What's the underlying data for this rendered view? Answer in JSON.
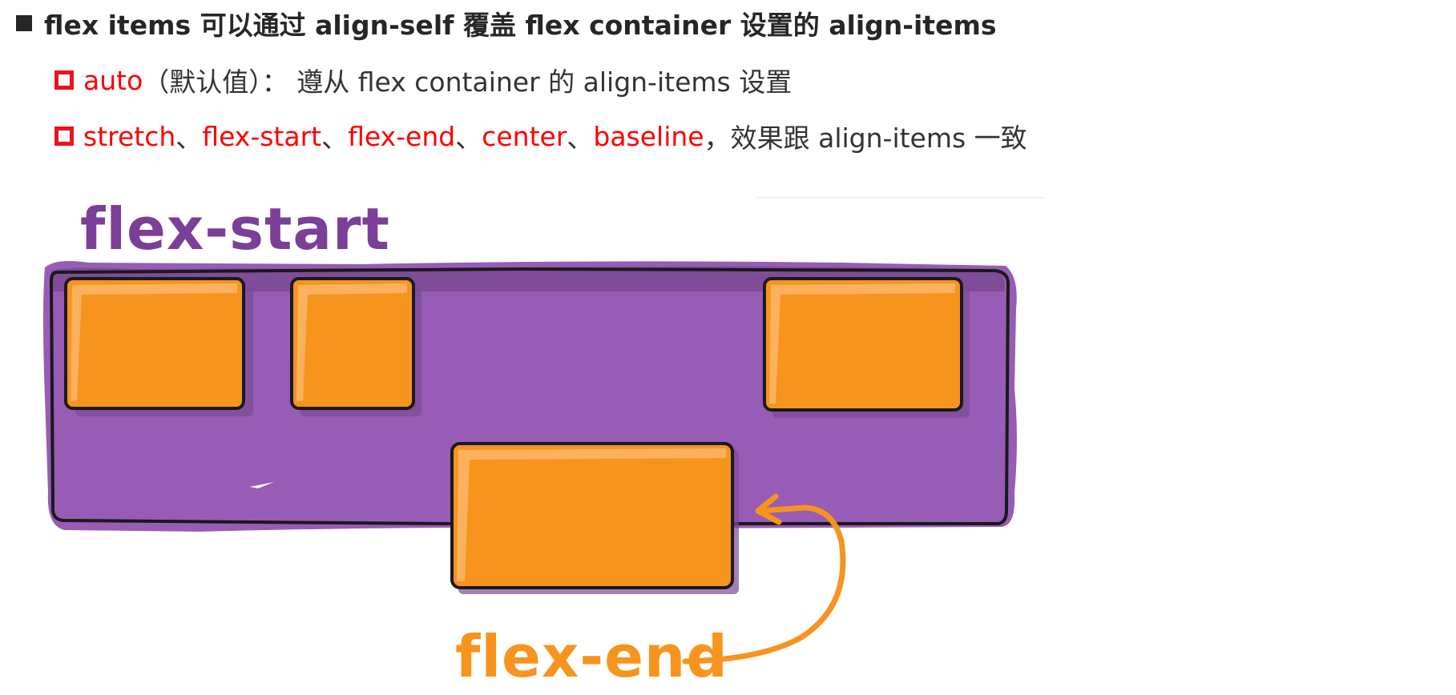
{
  "heading": {
    "text": "flex items 可以通过 align-self 覆盖 flex container 设置的 align-items"
  },
  "bullets": [
    {
      "parts": [
        {
          "text": "auto",
          "highlight": true
        },
        {
          "text": "（默认值）： 遵从 flex container 的 align-items 设置",
          "highlight": false
        }
      ]
    },
    {
      "parts": [
        {
          "text": "stretch",
          "highlight": true
        },
        {
          "text": "、",
          "highlight": false
        },
        {
          "text": "flex-start",
          "highlight": true
        },
        {
          "text": "、",
          "highlight": false
        },
        {
          "text": "flex-end",
          "highlight": true
        },
        {
          "text": "、",
          "highlight": false
        },
        {
          "text": "center",
          "highlight": true
        },
        {
          "text": "、",
          "highlight": false
        },
        {
          "text": "baseline",
          "highlight": true
        },
        {
          "text": "，效果跟 align-items 一致",
          "highlight": false
        }
      ]
    }
  ],
  "illustration": {
    "container_label": "flex-start",
    "item_label": "flex-end",
    "colors": {
      "container_fill": "#975cb5",
      "container_dark": "#7b4a95",
      "item_fill": "#f7941d",
      "item_highlight": "#fbb15d",
      "outline": "#1a1a1a",
      "container_label_color": "#7b3f98",
      "item_label_color": "#f7941d",
      "accent_red": "#ff0000"
    }
  }
}
